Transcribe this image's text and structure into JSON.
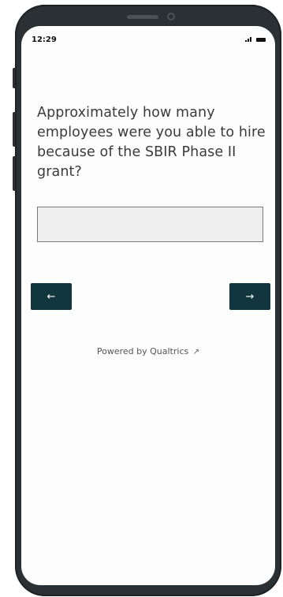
{
  "status": {
    "time": "12:29"
  },
  "survey": {
    "question": "Approximately how many employees were you able to hire because of the SBIR Phase II grant?",
    "answer_value": ""
  },
  "nav": {
    "prev_label": "←",
    "next_label": "→"
  },
  "footer": {
    "powered_by": "Powered by Qualtrics",
    "external_icon": "↗"
  }
}
